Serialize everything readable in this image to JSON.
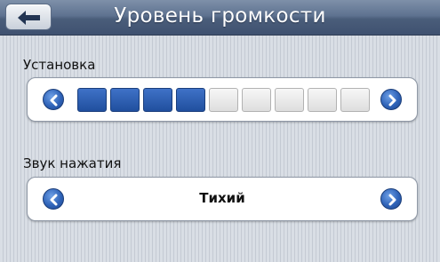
{
  "header": {
    "title": "Уровень громкости",
    "back_icon": "arrow-left-icon"
  },
  "volume": {
    "label": "Установка",
    "segments_total": 9,
    "level": 4,
    "accent_color": "#2a5cb0"
  },
  "key_sound": {
    "label": "Звук нажатия",
    "value": "Тихий"
  }
}
